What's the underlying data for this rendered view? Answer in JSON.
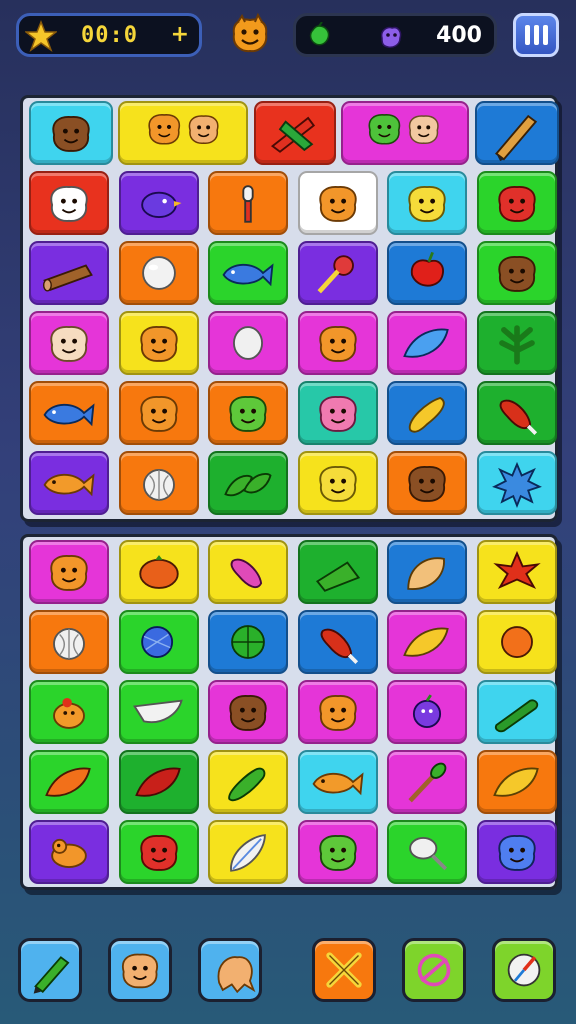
{
  "hud": {
    "timer": "00:0",
    "timer_icon": "star-icon",
    "add_time_symbol": "+",
    "score": "400",
    "score_icons": [
      "green-gem-icon",
      "purple-creature-icon"
    ],
    "mascot_icon": "orange-monster-face-icon",
    "pause_icon": "pause-icon"
  },
  "board_top": {
    "rows": [
      [
        {
          "icon": "brown-face",
          "color": "#3fd4ee"
        },
        {
          "icon": "two-orange-faces",
          "color": "#f6e21c"
        },
        {
          "icon": "red-green-leaves",
          "color": "#e8321e"
        },
        {
          "icon": "green-leaf-face-and-face",
          "color": "#e535d8"
        },
        {
          "icon": "pencil",
          "color": "#1e7ad6"
        }
      ],
      [
        {
          "icon": "white-fluffy-face",
          "color": "#e8321e"
        },
        {
          "icon": "purple-bird",
          "color": "#7a2ee0"
        },
        {
          "icon": "microphone",
          "color": "#f7780e"
        },
        {
          "icon": "orange-face",
          "color": "#ffffff"
        },
        {
          "icon": "yellow-face",
          "color": "#3fd4ee"
        },
        {
          "icon": "red-face",
          "color": "#2bd42b"
        }
      ],
      [
        {
          "icon": "log",
          "color": "#7a2ee0"
        },
        {
          "icon": "white-ball",
          "color": "#f7780e"
        },
        {
          "icon": "blue-fish",
          "color": "#2bd42b"
        },
        {
          "icon": "lollipop",
          "color": "#7a2ee0"
        },
        {
          "icon": "red-apple-bird",
          "color": "#1e7ad6"
        },
        {
          "icon": "brown-face",
          "color": "#2bd42b"
        }
      ],
      [
        {
          "icon": "pale-face",
          "color": "#e535d8"
        },
        {
          "icon": "orange-face",
          "color": "#f6e21c"
        },
        {
          "icon": "white-egg",
          "color": "#e535d8"
        },
        {
          "icon": "orange-face",
          "color": "#e535d8"
        },
        {
          "icon": "blue-leaf",
          "color": "#e535d8"
        },
        {
          "icon": "green-herb",
          "color": "#1eb02e"
        }
      ],
      [
        {
          "icon": "blue-fish",
          "color": "#f7780e"
        },
        {
          "icon": "orange-face",
          "color": "#f7780e"
        },
        {
          "icon": "green-face",
          "color": "#f7780e"
        },
        {
          "icon": "pink-face",
          "color": "#27c8a8"
        },
        {
          "icon": "yellow-squash",
          "color": "#1e7ad6"
        },
        {
          "icon": "red-drumstick",
          "color": "#1eb02e"
        }
      ],
      [
        {
          "icon": "orange-fish",
          "color": "#7a2ee0"
        },
        {
          "icon": "white-onion",
          "color": "#f7780e"
        },
        {
          "icon": "green-leaves",
          "color": "#1eb02e"
        },
        {
          "icon": "yellow-face",
          "color": "#f6e21c"
        },
        {
          "icon": "brown-face",
          "color": "#f7780e"
        },
        {
          "icon": "blue-splash",
          "color": "#3fd4ee"
        }
      ]
    ]
  },
  "board_bottom": {
    "rows": [
      [
        {
          "icon": "orange-face",
          "color": "#e535d8"
        },
        {
          "icon": "orange-tomato",
          "color": "#f6e21c"
        },
        {
          "icon": "pink-drumstick",
          "color": "#f6e21c"
        },
        {
          "icon": "green-broom",
          "color": "#1eb02e"
        },
        {
          "icon": "shell",
          "color": "#1e7ad6"
        },
        {
          "icon": "red-flower",
          "color": "#f6e21c"
        }
      ],
      [
        {
          "icon": "white-onion",
          "color": "#f7780e"
        },
        {
          "icon": "blue-ball",
          "color": "#2bd42b"
        },
        {
          "icon": "green-ball",
          "color": "#1e7ad6"
        },
        {
          "icon": "red-drumstick",
          "color": "#1e7ad6"
        },
        {
          "icon": "yellow-leaf",
          "color": "#e535d8"
        },
        {
          "icon": "orange-ball",
          "color": "#f6e21c"
        }
      ],
      [
        {
          "icon": "orange-bird",
          "color": "#2bd42b"
        },
        {
          "icon": "white-shell",
          "color": "#2bd42b"
        },
        {
          "icon": "brown-face",
          "color": "#e535d8"
        },
        {
          "icon": "orange-face",
          "color": "#e535d8"
        },
        {
          "icon": "purple-berry",
          "color": "#e535d8"
        },
        {
          "icon": "green-cucumber",
          "color": "#3fd4ee"
        }
      ],
      [
        {
          "icon": "orange-leaf",
          "color": "#2bd42b"
        },
        {
          "icon": "red-leaf",
          "color": "#1eb02e"
        },
        {
          "icon": "green-pickle",
          "color": "#f6e21c"
        },
        {
          "icon": "orange-fish",
          "color": "#3fd4ee"
        },
        {
          "icon": "green-mallet",
          "color": "#e535d8"
        },
        {
          "icon": "yellow-leaf",
          "color": "#f7780e"
        }
      ],
      [
        {
          "icon": "orange-duck",
          "color": "#7a2ee0"
        },
        {
          "icon": "red-face",
          "color": "#2bd42b"
        },
        {
          "icon": "white-feather",
          "color": "#f6e21c"
        },
        {
          "icon": "green-face",
          "color": "#e535d8"
        },
        {
          "icon": "white-spoon",
          "color": "#2bd42b"
        },
        {
          "icon": "blue-face",
          "color": "#7a2ee0"
        }
      ]
    ]
  },
  "powerups": [
    {
      "icon": "green-pencil-icon",
      "color": "#4fb2ee"
    },
    {
      "icon": "face-icon",
      "color": "#4fb2ee"
    },
    {
      "icon": "creature-icon",
      "color": "#4fb2ee"
    },
    {
      "icon": "crossed-swords-icon",
      "color": "#f7780e"
    },
    {
      "icon": "shuffle-icon",
      "color": "#7ed42b"
    },
    {
      "icon": "compass-icon",
      "color": "#7ed42b"
    }
  ]
}
